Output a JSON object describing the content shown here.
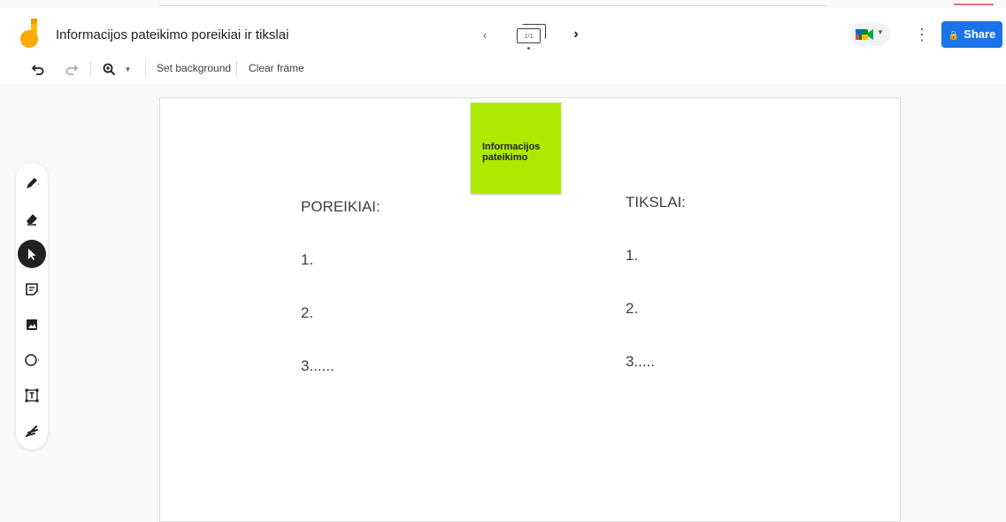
{
  "document": {
    "title": "Informacijos pateikimo poreikiai ir tikslai"
  },
  "frames": {
    "counter": "1/1"
  },
  "share": {
    "label": "Share"
  },
  "toolbar": {
    "set_background": "Set background",
    "clear_frame": "Clear frame"
  },
  "canvas": {
    "sticky_note": {
      "text": "Informacijos pateikimo",
      "color": "#aeea00"
    },
    "left_text": {
      "heading": "POREIKIAI:",
      "lines": [
        "1.",
        "2.",
        "3......"
      ]
    },
    "right_text": {
      "heading": "TIKSLAI:",
      "lines": [
        "1.",
        "2.",
        "3....."
      ]
    }
  },
  "tools": [
    "pen",
    "eraser",
    "select",
    "sticky-note",
    "image",
    "circle",
    "text-box",
    "laser"
  ],
  "colors": {
    "accent": "#1a73e8",
    "sticky": "#aeea00",
    "active_tool": "#202124"
  }
}
